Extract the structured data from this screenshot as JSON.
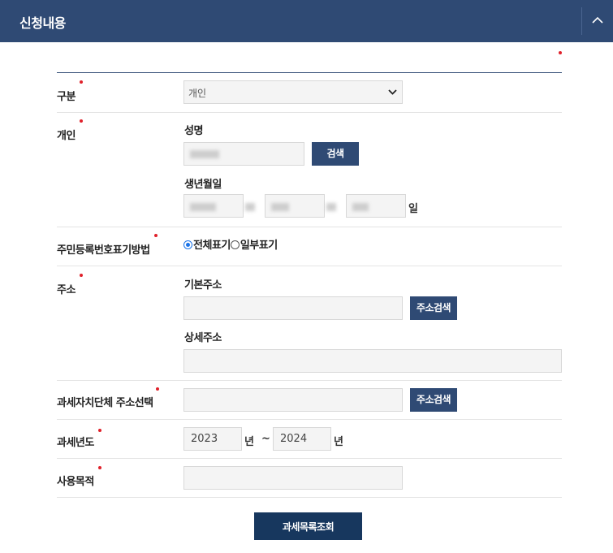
{
  "header": {
    "title": "신청내용",
    "collapse_icon": "chevron-up-icon"
  },
  "rows": {
    "category": {
      "label": "구분",
      "select_value": "개인"
    },
    "individual": {
      "label": "개인",
      "name_label": "성명",
      "search_button": "검색",
      "birth_label": "생년월일",
      "day_unit": "일"
    },
    "id_display": {
      "label": "주민등록번호표기방법",
      "option_full": "전체표기",
      "option_partial": "일부표기"
    },
    "address": {
      "label": "주소",
      "basic_label": "기본주소",
      "search_button": "주소검색",
      "detail_label": "상세주소"
    },
    "gov_select": {
      "label": "과세자치단체 주소선택",
      "search_button": "주소검색"
    },
    "tax_year": {
      "label": "과세년도",
      "from_value": "2023",
      "from_unit": "년",
      "tilde": "~",
      "to_value": "2024",
      "to_unit": "년"
    },
    "purpose": {
      "label": "사용목적"
    }
  },
  "submit_label": "과세목록조회",
  "colors": {
    "header_bg": "#2f4a74",
    "button_bg": "#2f4a74",
    "submit_bg": "#17375e",
    "required": "#e0202a"
  }
}
